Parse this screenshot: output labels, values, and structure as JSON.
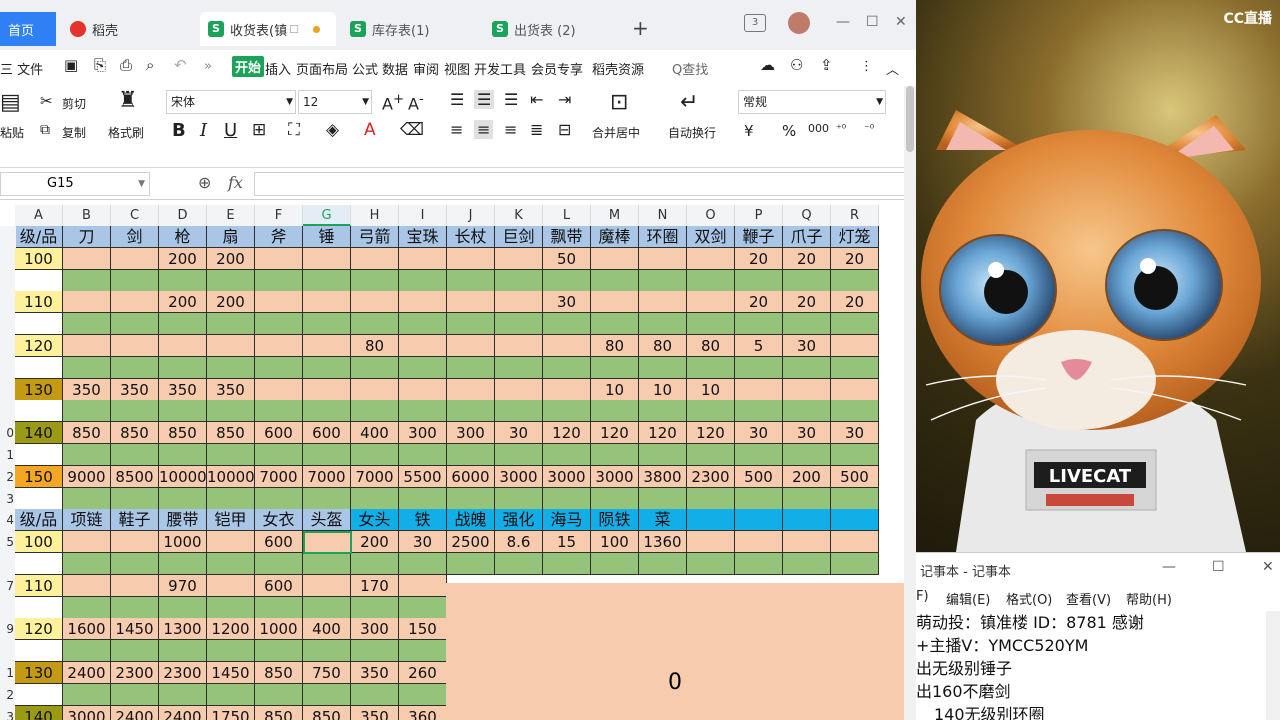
{
  "tabs": {
    "home": "首页",
    "docer": "稻壳",
    "active": "收货表(镇",
    "stock": "库存表(1)",
    "shipping": "出货表 (2)",
    "new_tab": "+"
  },
  "menu": {
    "file": "三 文件",
    "start": "开始",
    "items": [
      "插入",
      "页面布局",
      "公式",
      "数据",
      "审阅",
      "视图",
      "开发工具",
      "会员专享",
      "稻壳资源"
    ],
    "search": "Q查找"
  },
  "ribbon": {
    "cut": "剪切",
    "paste": "粘贴",
    "copy": "复制",
    "format_brush": "格式刷",
    "font_name": "宋体",
    "font_size": "12",
    "merge_center": "合并居中",
    "wrap": "自动换行",
    "number_format": "常规",
    "currency": "¥",
    "percent": "%"
  },
  "formula_bar": {
    "cell_ref": "G15",
    "fx": "fx"
  },
  "columns": [
    "A",
    "B",
    "C",
    "D",
    "E",
    "F",
    "G",
    "H",
    "I",
    "J",
    "K",
    "L",
    "M",
    "N",
    "O",
    "P",
    "Q",
    "R"
  ],
  "row_numbers": [
    "",
    "",
    "",
    "",
    "",
    "",
    "",
    "",
    "",
    "0",
    "1",
    "2",
    "3",
    "4",
    "5",
    "",
    "7",
    "",
    "9",
    "",
    "1",
    "2",
    "3"
  ],
  "weapons_header": [
    "级/品",
    "刀",
    "剑",
    "枪",
    "扇",
    "斧",
    "锤",
    "弓箭",
    "宝珠",
    "长杖",
    "巨剑",
    "飘带",
    "魔棒",
    "环圈",
    "双剑",
    "鞭子",
    "爪子",
    "灯笼"
  ],
  "weapon_rows": [
    {
      "level": "100",
      "vals": [
        "",
        "",
        "200",
        "200",
        "",
        "",
        "",
        "",
        "",
        "",
        "50",
        "",
        "",
        "",
        "20",
        "20",
        "20"
      ]
    },
    {
      "level": "110",
      "vals": [
        "",
        "",
        "200",
        "200",
        "",
        "",
        "",
        "",
        "",
        "",
        "30",
        "",
        "",
        "",
        "20",
        "20",
        "20"
      ]
    },
    {
      "level": "120",
      "vals": [
        "",
        "",
        "",
        "",
        "",
        "",
        "80",
        "",
        "",
        "",
        "",
        "80",
        "80",
        "80",
        "5",
        "30",
        ""
      ]
    },
    {
      "level": "130",
      "vals": [
        "350",
        "350",
        "350",
        "350",
        "",
        "",
        "",
        "",
        "",
        "",
        "",
        "10",
        "10",
        "10",
        "",
        "",
        ""
      ]
    },
    {
      "level": "140",
      "vals": [
        "850",
        "850",
        "850",
        "850",
        "600",
        "600",
        "400",
        "300",
        "300",
        "30",
        "120",
        "120",
        "120",
        "120",
        "30",
        "30",
        "30"
      ]
    },
    {
      "level": "150",
      "vals": [
        "9000",
        "8500",
        "10000",
        "10000",
        "7000",
        "7000",
        "7000",
        "5500",
        "6000",
        "3000",
        "3000",
        "3000",
        "3800",
        "2300",
        "500",
        "200",
        "500"
      ]
    }
  ],
  "armor_header": [
    "级/品",
    "项链",
    "鞋子",
    "腰带",
    "铠甲",
    "女衣",
    "头盔",
    "女头",
    "铁",
    "战魄",
    "强化",
    "海马",
    "陨铁",
    "菜"
  ],
  "armor_rows": [
    {
      "level": "100",
      "vals": [
        "",
        "",
        "1000",
        "",
        "600",
        "",
        "200",
        "30",
        "2500",
        "8.6",
        "15",
        "100",
        "1360"
      ]
    },
    {
      "level": "110",
      "vals": [
        "",
        "",
        "970",
        "",
        "600",
        "",
        "170"
      ]
    },
    {
      "level": "120",
      "vals": [
        "1600",
        "1450",
        "1300",
        "1200",
        "1000",
        "400",
        "300",
        "150"
      ]
    },
    {
      "level": "130",
      "vals": [
        "2400",
        "2300",
        "2300",
        "1450",
        "850",
        "750",
        "350",
        "260"
      ]
    },
    {
      "level": "140",
      "vals": [
        "3000",
        "2400",
        "2400",
        "1750",
        "850",
        "850",
        "350",
        "360"
      ]
    }
  ],
  "big_cell_value": "0",
  "cam": {
    "logo": "CC直播"
  },
  "notepad": {
    "title": "记事本 - 记事本",
    "menu": [
      "F)",
      "编辑(E)",
      "格式(O)",
      "查看(V)",
      "帮助(H)"
    ],
    "lines": [
      "萌动投：镇准楼 ID：8781 感谢",
      "+主播V：YMCC520YM",
      "出无级别锤子",
      "出160不磨剑",
      "140无级别环圈"
    ]
  },
  "colors": {
    "header_blue": "#a9c6e6",
    "header_cyan": "#12aee8",
    "salmon": "#f7cbae",
    "green": "#95c37a",
    "level_yellow": "#fff19b",
    "level_gold": "#c49a13",
    "level_olive": "#9a9a14",
    "level_orange": "#f5a623",
    "accent_green": "#1ba35a"
  }
}
